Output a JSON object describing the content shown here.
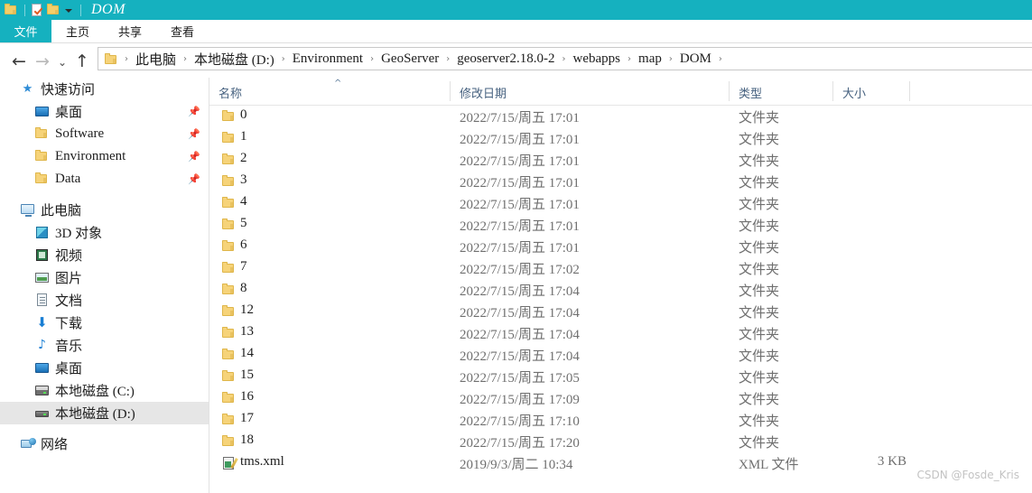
{
  "window": {
    "title": "DOM",
    "titlebar_color": "#15b1bf",
    "qat": [
      {
        "name": "folder-icon",
        "label": ""
      },
      {
        "name": "properties-check-icon",
        "label": ""
      },
      {
        "name": "new-folder-icon",
        "label": ""
      },
      {
        "name": "customize-chevron-icon",
        "label": ""
      }
    ]
  },
  "ribbon": {
    "tabs": [
      {
        "label": "文件",
        "active": true
      },
      {
        "label": "主页",
        "active": false
      },
      {
        "label": "共享",
        "active": false
      },
      {
        "label": "查看",
        "active": false
      }
    ]
  },
  "addressbar": {
    "back": "←",
    "forward": "→",
    "recent": "⌄",
    "up": "↑",
    "separator": "›",
    "crumbs": [
      "此电脑",
      "本地磁盘 (D:)",
      "Environment",
      "GeoServer",
      "geoserver2.18.0-2",
      "webapps",
      "map",
      "DOM"
    ]
  },
  "sidebar": {
    "groups": [
      {
        "header": {
          "label": "快速访问",
          "icon": "star-pin-icon"
        },
        "items": [
          {
            "label": "桌面",
            "icon": "desktop-icon",
            "pinned": true,
            "selected": false
          },
          {
            "label": "Software",
            "icon": "folder-icon",
            "pinned": true,
            "selected": false
          },
          {
            "label": "Environment",
            "icon": "folder-icon",
            "pinned": true,
            "selected": false
          },
          {
            "label": "Data",
            "icon": "folder-icon",
            "pinned": true,
            "selected": false
          }
        ]
      },
      {
        "header": {
          "label": "此电脑",
          "icon": "this-pc-icon"
        },
        "items": [
          {
            "label": "3D 对象",
            "icon": "3d-objects-icon",
            "pinned": false,
            "selected": false
          },
          {
            "label": "视频",
            "icon": "videos-icon",
            "pinned": false,
            "selected": false
          },
          {
            "label": "图片",
            "icon": "pictures-icon",
            "pinned": false,
            "selected": false
          },
          {
            "label": "文档",
            "icon": "documents-icon",
            "pinned": false,
            "selected": false
          },
          {
            "label": "下载",
            "icon": "downloads-icon",
            "pinned": false,
            "selected": false
          },
          {
            "label": "音乐",
            "icon": "music-icon",
            "pinned": false,
            "selected": false
          },
          {
            "label": "桌面",
            "icon": "desktop-icon",
            "pinned": false,
            "selected": false
          },
          {
            "label": "本地磁盘 (C:)",
            "icon": "local-disk-c-icon",
            "pinned": false,
            "selected": false
          },
          {
            "label": "本地磁盘 (D:)",
            "icon": "local-disk-d-icon",
            "pinned": false,
            "selected": true
          }
        ]
      },
      {
        "header": {
          "label": "网络",
          "icon": "network-icon"
        },
        "items": []
      }
    ],
    "pin_glyph": "📌"
  },
  "filelist": {
    "columns": [
      {
        "key": "name",
        "label": "名称",
        "sorted": true,
        "sort_dir": "asc",
        "sort_caret": "^"
      },
      {
        "key": "date",
        "label": "修改日期",
        "sorted": false
      },
      {
        "key": "type",
        "label": "类型",
        "sorted": false
      },
      {
        "key": "size",
        "label": "大小",
        "sorted": false
      }
    ],
    "rows": [
      {
        "name": "0",
        "date": "2022/7/15/周五 17:01",
        "type": "文件夹",
        "size": "",
        "icon": "folder-icon"
      },
      {
        "name": "1",
        "date": "2022/7/15/周五 17:01",
        "type": "文件夹",
        "size": "",
        "icon": "folder-icon"
      },
      {
        "name": "2",
        "date": "2022/7/15/周五 17:01",
        "type": "文件夹",
        "size": "",
        "icon": "folder-icon"
      },
      {
        "name": "3",
        "date": "2022/7/15/周五 17:01",
        "type": "文件夹",
        "size": "",
        "icon": "folder-icon"
      },
      {
        "name": "4",
        "date": "2022/7/15/周五 17:01",
        "type": "文件夹",
        "size": "",
        "icon": "folder-icon"
      },
      {
        "name": "5",
        "date": "2022/7/15/周五 17:01",
        "type": "文件夹",
        "size": "",
        "icon": "folder-icon"
      },
      {
        "name": "6",
        "date": "2022/7/15/周五 17:01",
        "type": "文件夹",
        "size": "",
        "icon": "folder-icon"
      },
      {
        "name": "7",
        "date": "2022/7/15/周五 17:02",
        "type": "文件夹",
        "size": "",
        "icon": "folder-icon"
      },
      {
        "name": "8",
        "date": "2022/7/15/周五 17:04",
        "type": "文件夹",
        "size": "",
        "icon": "folder-icon"
      },
      {
        "name": "12",
        "date": "2022/7/15/周五 17:04",
        "type": "文件夹",
        "size": "",
        "icon": "folder-icon"
      },
      {
        "name": "13",
        "date": "2022/7/15/周五 17:04",
        "type": "文件夹",
        "size": "",
        "icon": "folder-icon"
      },
      {
        "name": "14",
        "date": "2022/7/15/周五 17:04",
        "type": "文件夹",
        "size": "",
        "icon": "folder-icon"
      },
      {
        "name": "15",
        "date": "2022/7/15/周五 17:05",
        "type": "文件夹",
        "size": "",
        "icon": "folder-icon"
      },
      {
        "name": "16",
        "date": "2022/7/15/周五 17:09",
        "type": "文件夹",
        "size": "",
        "icon": "folder-icon"
      },
      {
        "name": "17",
        "date": "2022/7/15/周五 17:10",
        "type": "文件夹",
        "size": "",
        "icon": "folder-icon"
      },
      {
        "name": "18",
        "date": "2022/7/15/周五 17:20",
        "type": "文件夹",
        "size": "",
        "icon": "folder-icon"
      },
      {
        "name": "tms.xml",
        "date": "2019/9/3/周二 10:34",
        "type": "XML 文件",
        "size": "3 KB",
        "icon": "xml-file-icon"
      }
    ]
  },
  "watermark": {
    "text": "CSDN @Fosde_Kris"
  }
}
